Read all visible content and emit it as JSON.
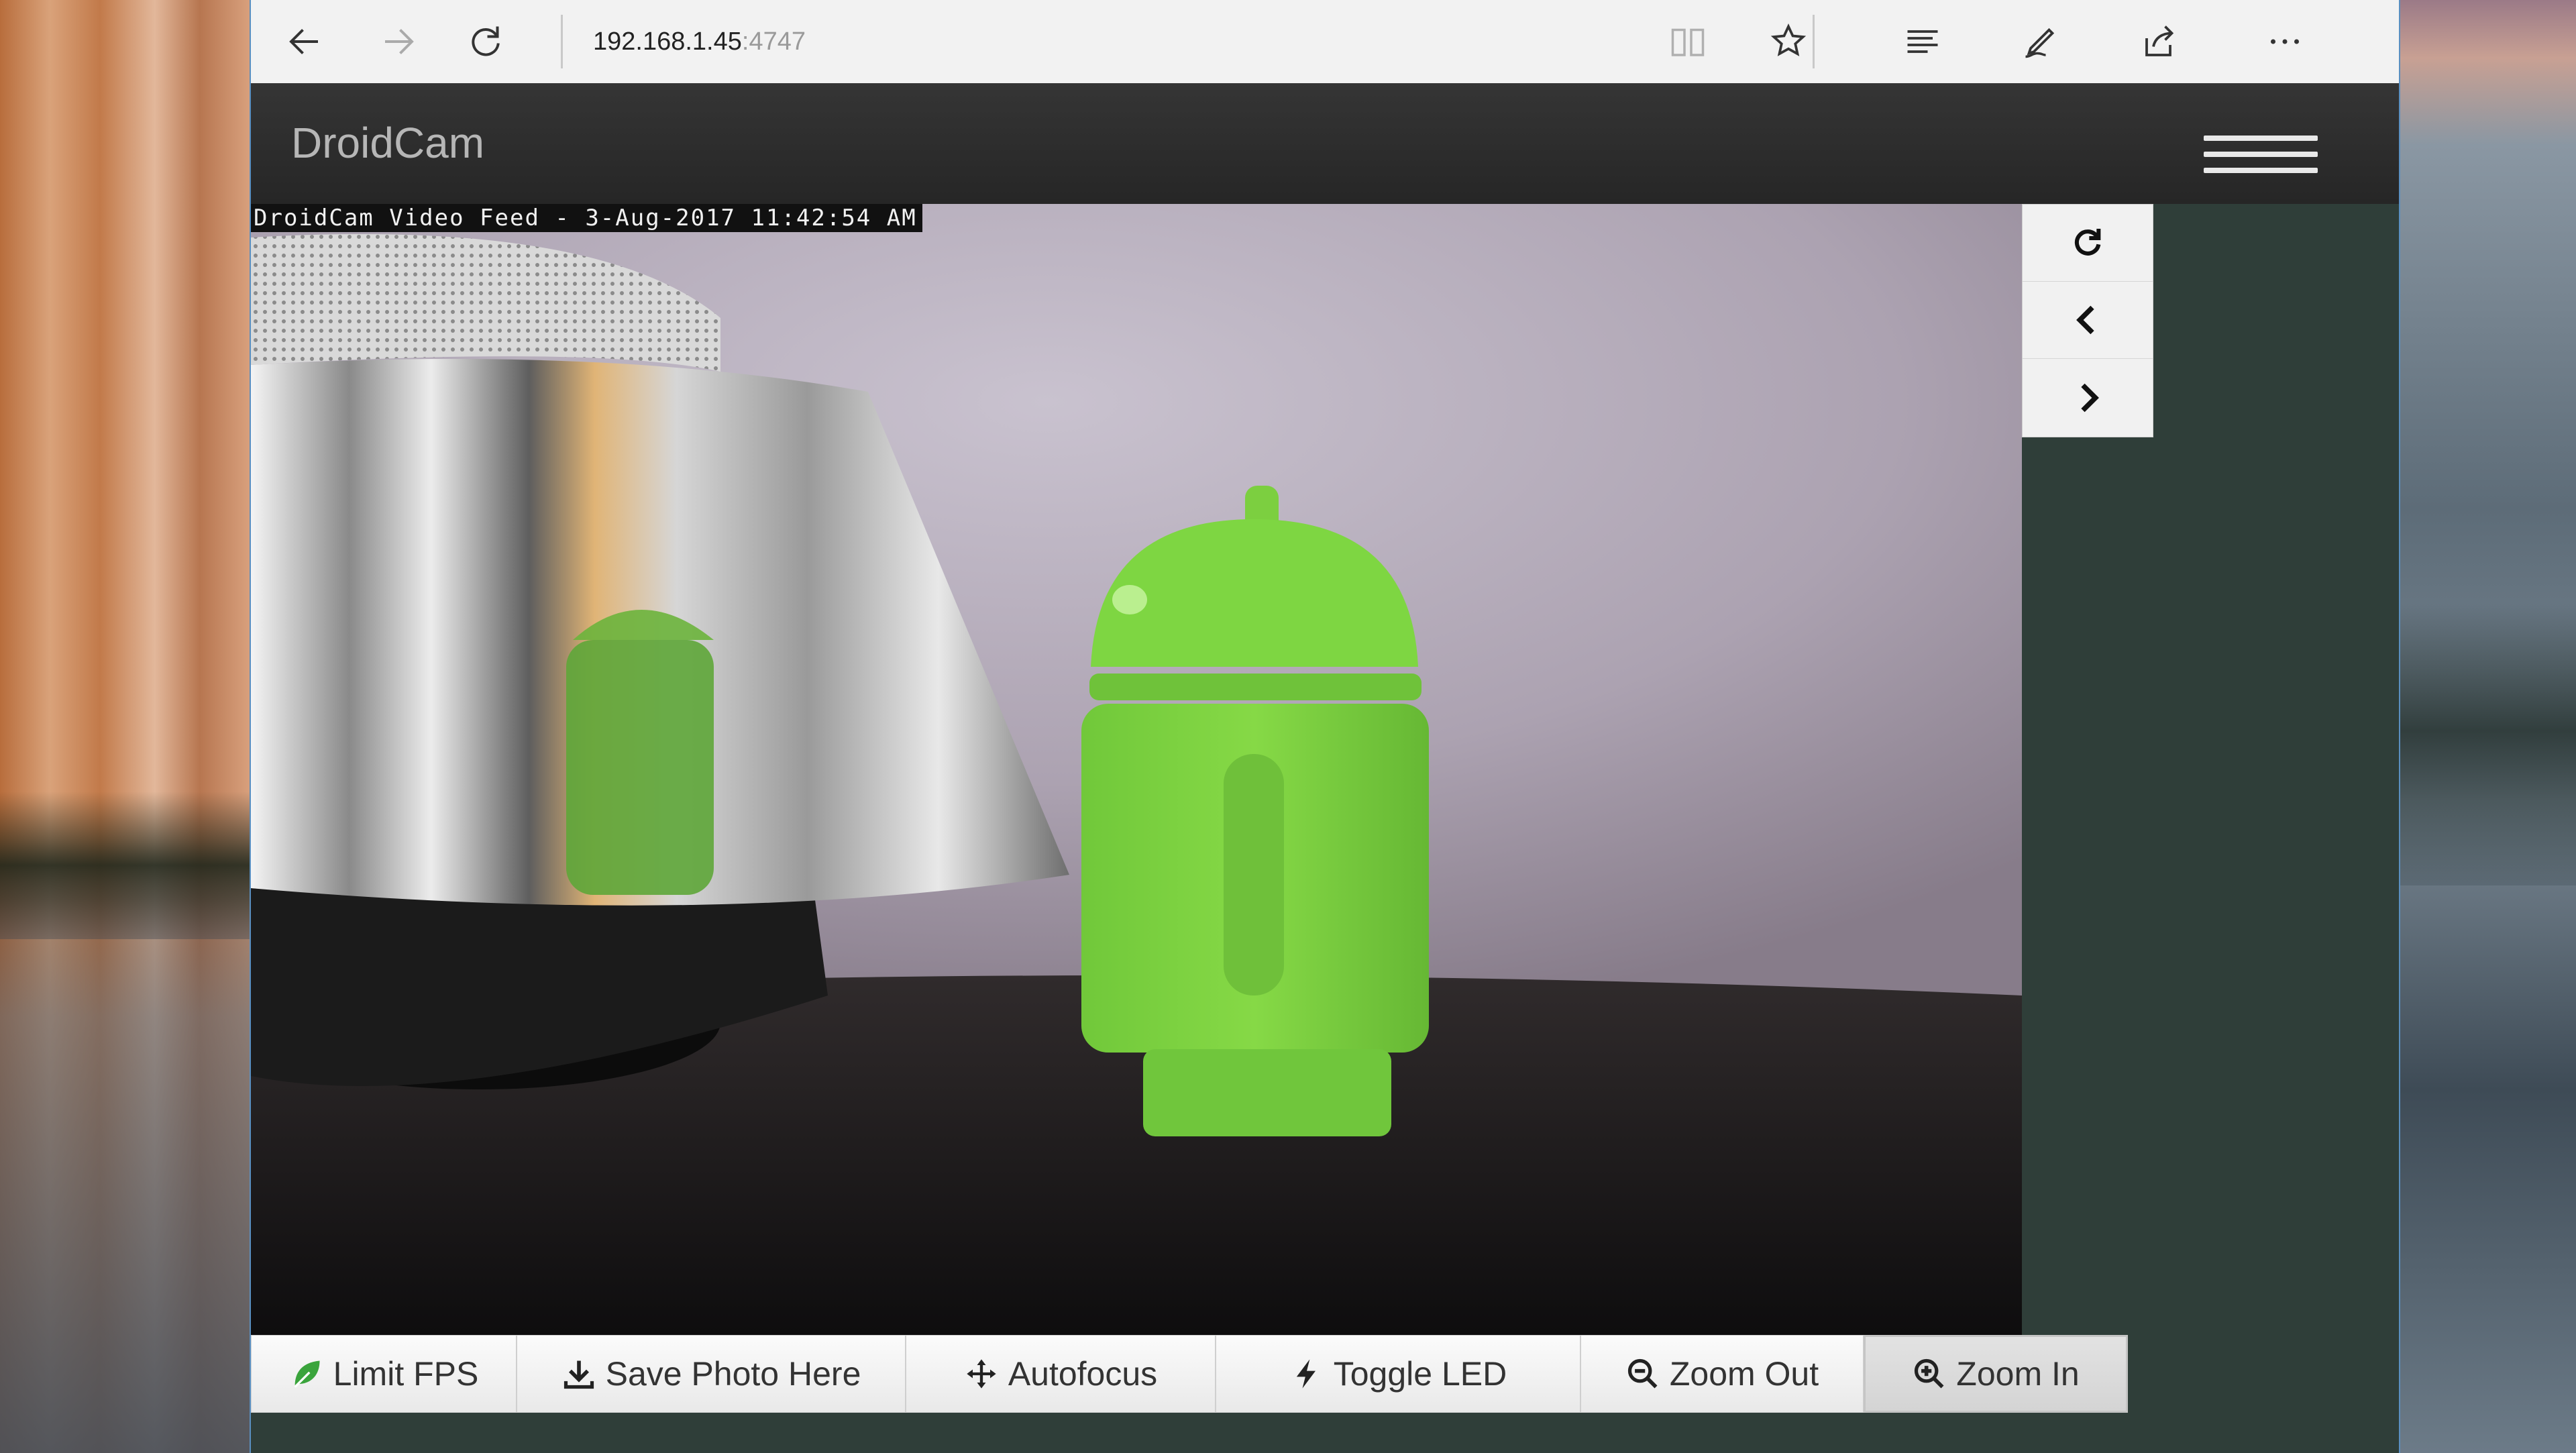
{
  "browser": {
    "address_host": "192.168.1.45",
    "address_port": ":4747",
    "icons": [
      "back-arrow-icon",
      "forward-arrow-icon",
      "refresh-icon",
      "reading-view-icon",
      "favorite-star-icon",
      "hub-icon",
      "web-note-icon",
      "share-icon",
      "more-icon"
    ]
  },
  "app": {
    "title": "DroidCam"
  },
  "video": {
    "overlay_text": "DroidCam Video Feed -  3-Aug-2017 11:42:54 AM"
  },
  "side_controls": {
    "icons": [
      "refresh-icon",
      "chevron-left-icon",
      "chevron-right-icon"
    ]
  },
  "controls": {
    "limit_fps": "Limit FPS",
    "save_photo": "Save Photo Here",
    "autofocus": "Autofocus",
    "toggle_led": "Toggle LED",
    "zoom_out": "Zoom Out",
    "zoom_in": "Zoom In"
  },
  "colors": {
    "header_bg": "#2b2b2b",
    "page_bg": "#2f3e39",
    "leaf_green": "#3aa43c",
    "android_green": "#7fd43c"
  }
}
